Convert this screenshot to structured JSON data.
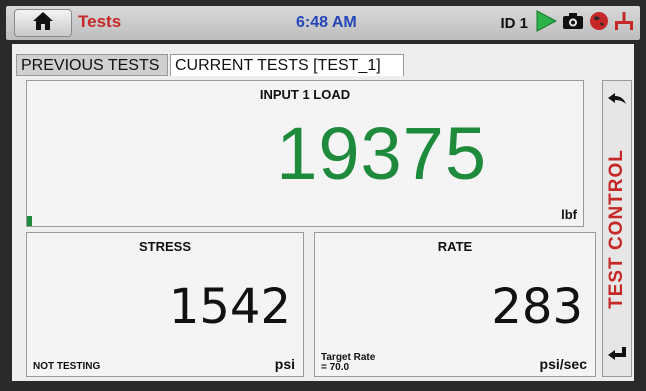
{
  "topbar": {
    "app_title": "Tests",
    "time": "6:48 AM",
    "id_label": "ID 1",
    "icons": [
      "home-icon",
      "play-icon",
      "camera-icon",
      "globe-icon",
      "network-icon"
    ]
  },
  "tabs": [
    {
      "label": "PREVIOUS TESTS",
      "active": false
    },
    {
      "label": "CURRENT TESTS [TEST_1]",
      "active": true
    }
  ],
  "load": {
    "title": "INPUT 1 LOAD",
    "value": "19375",
    "unit": "lbf"
  },
  "stress": {
    "title": "STRESS",
    "value": "1542",
    "unit": "psi",
    "status": "NOT TESTING"
  },
  "rate": {
    "title": "RATE",
    "value": "283",
    "unit": "psi/sec",
    "target_line1": "Target Rate",
    "target_line2": "= 70.0"
  },
  "sidebar": {
    "label": "TEST CONTROL"
  },
  "colors": {
    "accent_red": "#c62828",
    "value_green": "#1e8a3c",
    "clock_blue": "#2446b8"
  }
}
